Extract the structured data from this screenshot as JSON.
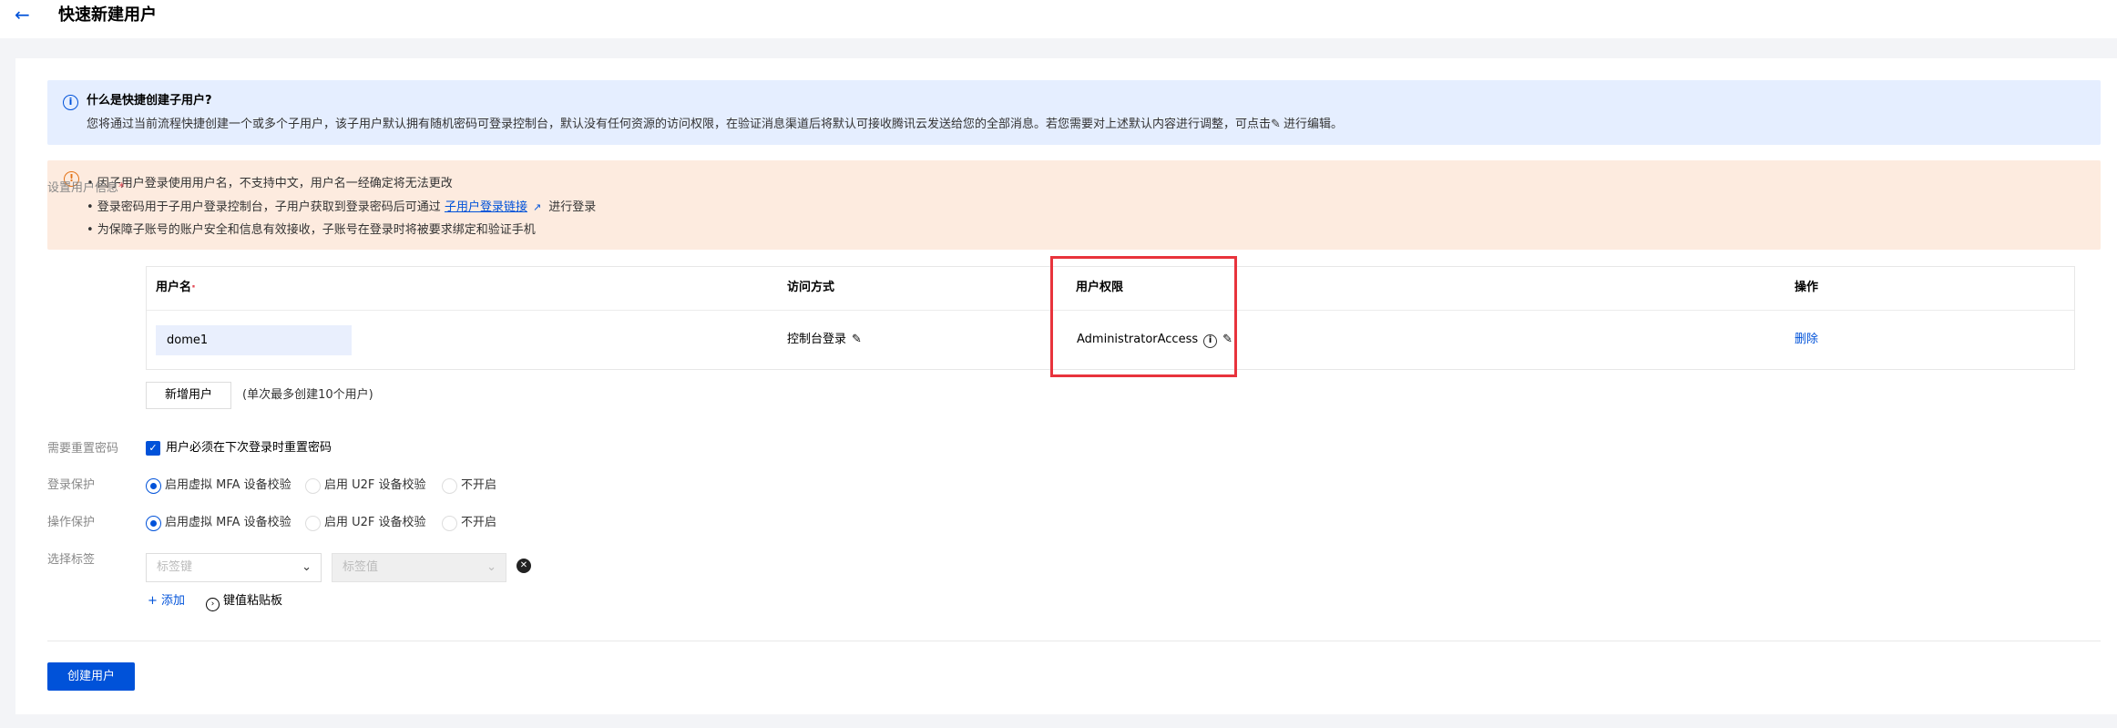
{
  "header": {
    "back_icon": "arrow-left-icon",
    "title": "快速新建用户"
  },
  "info_banner": {
    "icon": "info-icon",
    "title": "什么是快捷创建子用户?",
    "text_before": "您将通过当前流程快捷创建一个或多个子用户，该子用户默认拥有随机密码可登录控制台，默认没有任何资源的访问权限，在验证消息渠道后将默认可接收腾讯云发送给您的全部消息。若您需要对上述默认内容进行调整，可点击",
    "text_after": "进行编辑。"
  },
  "warning_banner": {
    "icon": "warning-icon",
    "line1": "• 因子用户登录使用用户名，不支持中文，用户名一经确定将无法更改",
    "line2_before": "• 登录密码用于子用户登录控制台，子用户获取到登录密码后可通过",
    "line2_link": "子用户登录链接",
    "line2_after": "进行登录",
    "line3": "• 为保障子账号的账户安全和信息有效接收，子账号在登录时将被要求绑定和验证手机"
  },
  "user_info": {
    "label": "设置用户信息",
    "required_mark": "*",
    "columns": {
      "username": "用户名",
      "access": "访问方式",
      "permission": "用户权限",
      "action": "操作"
    },
    "rows": [
      {
        "username": "dome1",
        "access": "控制台登录",
        "permission": "AdministratorAccess",
        "action": "删除"
      }
    ],
    "add_button": "新增用户",
    "hint": "(单次最多创建10个用户)"
  },
  "reset_password": {
    "label": "需要重置密码",
    "checkbox_label": "用户必须在下次登录时重置密码",
    "checked": true
  },
  "login_protection": {
    "label": "登录保护",
    "options": [
      "启用虚拟 MFA 设备校验",
      "启用 U2F 设备校验",
      "不开启"
    ],
    "selected": 0
  },
  "operation_protection": {
    "label": "操作保护",
    "options": [
      "启用虚拟 MFA 设备校验",
      "启用 U2F 设备校验",
      "不开启"
    ],
    "selected": 0
  },
  "tags": {
    "label": "选择标签",
    "key_placeholder": "标签键",
    "value_placeholder": "标签值",
    "add_label": "+ 添加",
    "paste_label": "键值粘贴板"
  },
  "submit": {
    "label": "创建用户"
  },
  "colors": {
    "primary": "#0052d9",
    "info_bg": "#e5eeff",
    "warn_bg": "#fdebdf",
    "highlight": "#e8333c"
  }
}
